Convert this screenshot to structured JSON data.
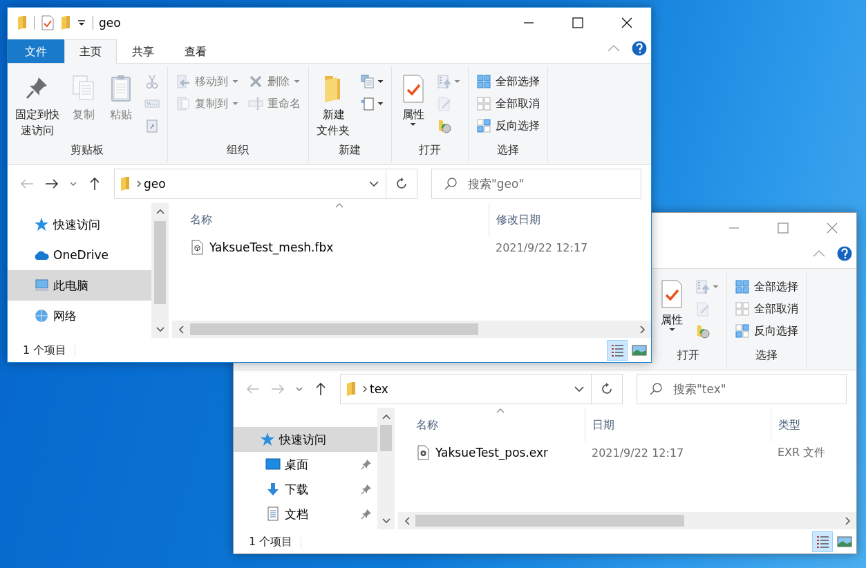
{
  "windows": [
    {
      "active": true,
      "title": "geo",
      "tabs": [
        {
          "label": "文件",
          "kind": "file",
          "selected": false
        },
        {
          "label": "主页",
          "kind": "tab",
          "selected": true
        },
        {
          "label": "共享",
          "kind": "tab",
          "selected": false
        },
        {
          "label": "查看",
          "kind": "tab",
          "selected": false
        }
      ],
      "ribbon": [
        {
          "label": "剪贴板",
          "columns": [
            [
              {
                "kind": "pin",
                "label": "固定到快速访问",
                "disabled": false
              }
            ],
            [
              {
                "kind": "copy",
                "label": "复制",
                "disabled": true
              }
            ],
            [
              {
                "kind": "paste",
                "label": "粘贴",
                "disabled": true
              }
            ],
            [
              {
                "kind": "cut",
                "disabled": true
              },
              {
                "kind": "copy-path",
                "disabled": true
              },
              {
                "kind": "paste-shortcut",
                "disabled": true
              }
            ]
          ]
        },
        {
          "label": "组织",
          "columns": [
            [
              {
                "kind": "move-to",
                "label": "移动到",
                "disabled": true
              },
              {
                "kind": "copy-to",
                "label": "复制到",
                "disabled": true
              }
            ],
            [
              {
                "kind": "delete",
                "label": "删除",
                "disabled": true
              },
              {
                "kind": "rename",
                "label": "重命名",
                "disabled": true
              }
            ]
          ]
        },
        {
          "label": "新建",
          "columns": [
            [
              {
                "kind": "new-folder",
                "label": "新建文件夹",
                "disabled": false
              }
            ],
            [
              {
                "kind": "new-item",
                "disabled": false
              },
              {
                "kind": "easy-access",
                "disabled": false
              }
            ]
          ]
        },
        {
          "label": "打开",
          "columns": [
            [
              {
                "kind": "properties",
                "label": "属性",
                "disabled": false
              }
            ],
            [
              {
                "kind": "open",
                "disabled": true
              },
              {
                "kind": "edit",
                "disabled": true
              },
              {
                "kind": "history",
                "disabled": false
              }
            ]
          ]
        },
        {
          "label": "选择",
          "columns": [
            [
              {
                "kind": "select-all",
                "label": "全部选择",
                "disabled": false
              },
              {
                "kind": "select-none",
                "label": "全部取消",
                "disabled": false
              },
              {
                "kind": "invert",
                "label": "反向选择",
                "disabled": false
              }
            ]
          ]
        }
      ],
      "navigation": {
        "back_enabled": false,
        "forward_enabled": true
      },
      "path": [
        "geo"
      ],
      "search_placeholder": "搜索\"geo\"",
      "nav_pane": [
        {
          "label": "快速访问",
          "kind": "quick-access",
          "selected": false
        },
        {
          "label": "OneDrive",
          "kind": "onedrive",
          "selected": false
        },
        {
          "label": "此电脑",
          "kind": "this-pc",
          "selected": true
        },
        {
          "label": "网络",
          "kind": "network",
          "selected": false
        }
      ],
      "columns": [
        {
          "label": "名称",
          "sorted": true
        },
        {
          "label": "修改日期",
          "sorted": false
        }
      ],
      "files": [
        {
          "kind": "model",
          "cells": [
            "YaksueTest_mesh.fbx",
            "2021/9/22 12:17"
          ]
        }
      ],
      "status": "1 个项目",
      "views": [
        {
          "kind": "details",
          "selected": true
        },
        {
          "kind": "large-icons",
          "selected": false
        }
      ]
    },
    {
      "active": false,
      "ribbon": [
        {
          "label": "打开",
          "columns": [
            [
              {
                "kind": "properties",
                "label": "属性",
                "disabled": false
              }
            ],
            [
              {
                "kind": "open",
                "disabled": true
              },
              {
                "kind": "edit",
                "disabled": true
              },
              {
                "kind": "history",
                "disabled": false
              }
            ]
          ]
        },
        {
          "label": "选择",
          "columns": [
            [
              {
                "kind": "select-all",
                "label": "全部选择",
                "disabled": false
              },
              {
                "kind": "select-none",
                "label": "全部取消",
                "disabled": false
              },
              {
                "kind": "invert",
                "label": "反向选择",
                "disabled": false
              }
            ]
          ]
        }
      ],
      "navigation": {
        "back_enabled": false,
        "forward_enabled": false
      },
      "path": [
        "tex"
      ],
      "search_placeholder": "搜索\"tex\"",
      "nav_pane": [
        {
          "label": "快速访问",
          "kind": "quick-access",
          "selected": true,
          "children": [
            {
              "label": "桌面",
              "kind": "desktop",
              "selected": false,
              "pinned": true
            },
            {
              "label": "下载",
              "kind": "downloads",
              "selected": false,
              "pinned": true
            },
            {
              "label": "文档",
              "kind": "documents",
              "selected": false,
              "pinned": true
            }
          ]
        }
      ],
      "columns": [
        {
          "label": "名称",
          "sorted": true
        },
        {
          "label": "日期",
          "sorted": false
        },
        {
          "label": "类型",
          "sorted": false
        }
      ],
      "files": [
        {
          "kind": "image",
          "cells": [
            "YaksueTest_pos.exr",
            "2021/9/22 12:17",
            "EXR 文件"
          ]
        }
      ],
      "status": "1 个项目",
      "views": [
        {
          "kind": "details",
          "selected": true
        },
        {
          "kind": "large-icons",
          "selected": false
        }
      ]
    }
  ]
}
